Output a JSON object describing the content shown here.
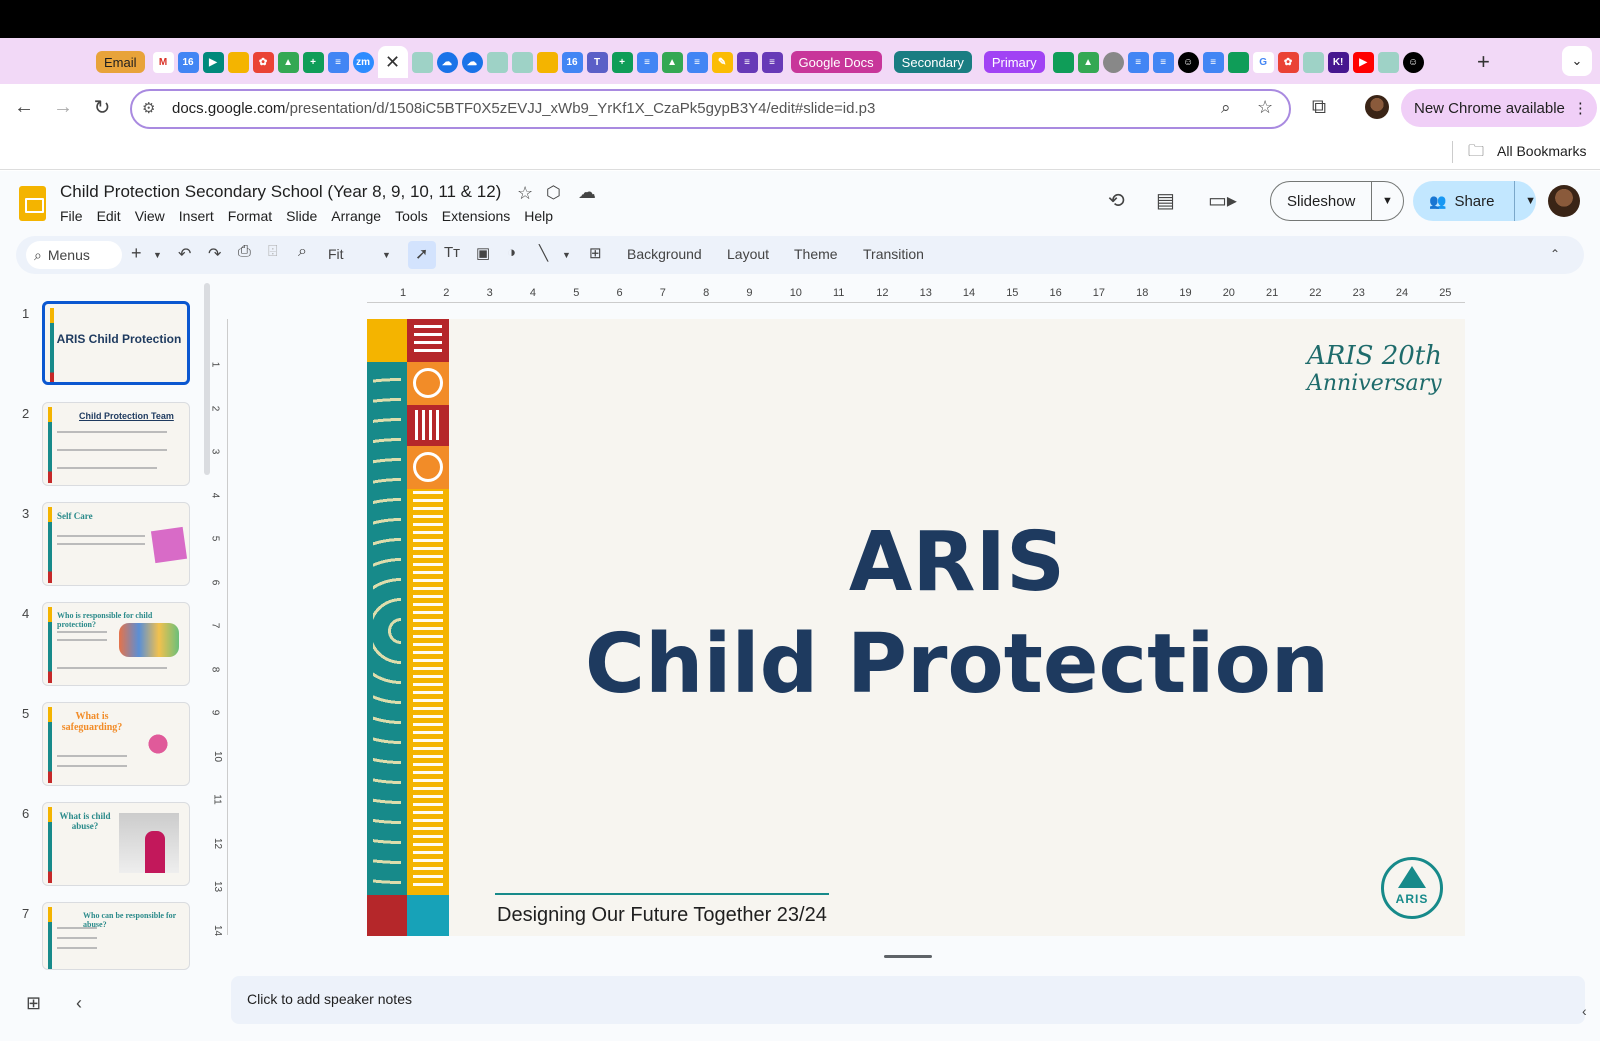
{
  "browser": {
    "tab_groups": [
      {
        "label": "Email",
        "color": "#e8a33a"
      },
      {
        "label": "Google Docs",
        "color": "#c8369a"
      },
      {
        "label": "Secondary",
        "color": "#1a7d82"
      },
      {
        "label": "Primary",
        "color": "#a142f4"
      }
    ],
    "active_tab_close": "✕",
    "new_tab": "+",
    "url_host": "docs.google.com",
    "url_path": "/presentation/d/1508iC5BTF0X5zEVJJ_xWb9_YrKf1X_CzaPk5gypB3Y4/edit#slide=id.p3",
    "new_chrome": "New Chrome available",
    "all_bookmarks": "All Bookmarks"
  },
  "app": {
    "title": "Child Protection Secondary School (Year 8, 9, 10, 11 & 12)",
    "menu": [
      "File",
      "Edit",
      "View",
      "Insert",
      "Format",
      "Slide",
      "Arrange",
      "Tools",
      "Extensions",
      "Help"
    ],
    "slideshow": "Slideshow",
    "share": "Share",
    "toolbar": {
      "search": "Menus",
      "zoom": "Fit",
      "background": "Background",
      "layout": "Layout",
      "theme": "Theme",
      "transition": "Transition"
    }
  },
  "filmstrip": [
    {
      "num": "1",
      "title": "ARIS Child Protection"
    },
    {
      "num": "2",
      "title": "Child Protection Team"
    },
    {
      "num": "3",
      "title": "Self Care"
    },
    {
      "num": "4",
      "title": "Who is responsible for child protection?"
    },
    {
      "num": "5",
      "title": "What is safeguarding?"
    },
    {
      "num": "6",
      "title": "What is child abuse?"
    },
    {
      "num": "7",
      "title": "Who can be responsible for abuse?"
    }
  ],
  "ruler": {
    "h": [
      "1",
      "2",
      "3",
      "4",
      "5",
      "6",
      "7",
      "8",
      "9",
      "10",
      "11",
      "12",
      "13",
      "14",
      "15",
      "16",
      "17",
      "18",
      "19",
      "20",
      "21",
      "22",
      "23",
      "24",
      "25"
    ],
    "v": [
      "1",
      "2",
      "3",
      "4",
      "5",
      "6",
      "7",
      "8",
      "9",
      "10",
      "11",
      "12",
      "13",
      "14"
    ]
  },
  "slide": {
    "line1": "ARIS",
    "line2": "Child Protection",
    "footer": "Designing Our Future Together 23/24",
    "anniv_top": "ARIS 20th",
    "anniv_bottom": "Anniversary",
    "logo_text": "ARIS"
  },
  "notes_placeholder": "Click to add speaker notes"
}
